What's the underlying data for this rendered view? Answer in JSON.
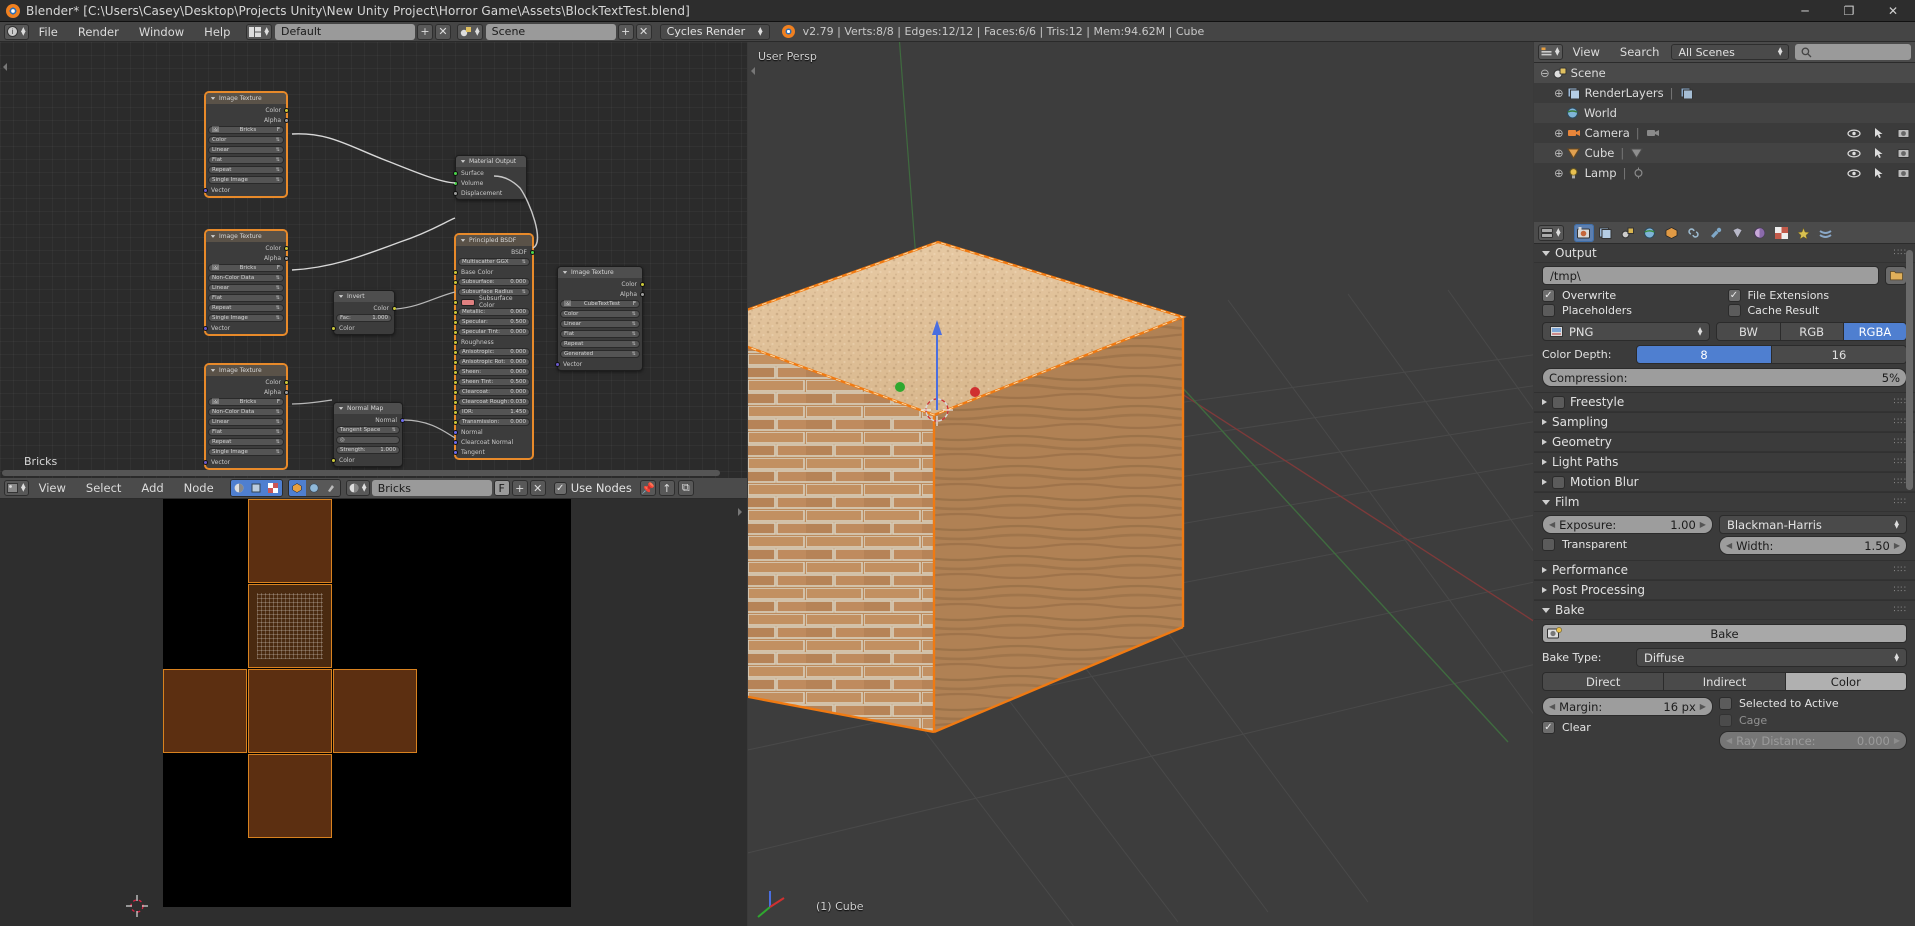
{
  "window": {
    "title": "Blender* [C:\\Users\\Casey\\Desktop\\Projects Unity\\New Unity Project\\Horror Game\\Assets\\BlockTextTest.blend]",
    "minimize": "─",
    "maximize": "❐",
    "close": "✕"
  },
  "topbar": {
    "menus": [
      "File",
      "Render",
      "Window",
      "Help"
    ],
    "screen_layout": "Default",
    "scene_name": "Scene",
    "engine": "Cycles Render",
    "add_label": "+",
    "remove_label": "✕",
    "status": "v2.79 | Verts:8/8 | Edges:12/12 | Faces:6/6 | Tris:12 | Mem:94.62M | Cube"
  },
  "node_editor": {
    "menus": [
      "View",
      "Select",
      "Add",
      "Node"
    ],
    "material": "Bricks",
    "material_f": "F",
    "use_nodes": "Use Nodes",
    "breadcrumb": "Bricks",
    "nodes": [
      {
        "title": "Image Texture",
        "image": "Bricks",
        "outputs": [
          "Color",
          "Alpha"
        ],
        "props": [
          "Color",
          "Linear",
          "Flat",
          "Repeat",
          "Single Image"
        ],
        "inputs": [
          "Vector"
        ]
      },
      {
        "title": "Image Texture",
        "image": "Bricks",
        "outputs": [
          "Color",
          "Alpha"
        ],
        "props": [
          "Non-Color Data",
          "Linear",
          "Flat",
          "Repeat",
          "Single Image"
        ],
        "inputs": [
          "Vector"
        ]
      },
      {
        "title": "Image Texture",
        "image": "Bricks",
        "outputs": [
          "Color",
          "Alpha"
        ],
        "props": [
          "Non-Color Data",
          "Linear",
          "Flat",
          "Repeat",
          "Single Image"
        ],
        "inputs": [
          "Vector"
        ]
      },
      {
        "title": "Invert",
        "outputs": [
          "Color"
        ],
        "fac_label": "Fac:",
        "fac_value": "1.000",
        "inputs": [
          "Color"
        ]
      },
      {
        "title": "Normal Map",
        "outputs": [
          "Normal"
        ],
        "space": "Tangent Space",
        "strength_label": "Strength:",
        "strength_value": "1.000",
        "inputs": [
          "Color"
        ]
      },
      {
        "title": "Material Output",
        "inputs": [
          "Surface",
          "Volume",
          "Displacement"
        ]
      },
      {
        "title": "Principled BSDF",
        "outputs": [
          "BSDF"
        ],
        "distribution": "Multiscatter GGX",
        "rows": [
          {
            "label": "Base Color",
            "value": "",
            "type": "socket"
          },
          {
            "label": "Subsurface:",
            "value": "0.000",
            "type": "num"
          },
          {
            "label": "Subsurface Radius",
            "value": "",
            "type": "dd"
          },
          {
            "label": "Subsurface Color",
            "value": "",
            "type": "color"
          },
          {
            "label": "Metallic:",
            "value": "0.000",
            "type": "num"
          },
          {
            "label": "Specular:",
            "value": "0.500",
            "type": "num"
          },
          {
            "label": "Specular Tint:",
            "value": "0.000",
            "type": "num"
          },
          {
            "label": "Roughness",
            "value": "",
            "type": "socket"
          },
          {
            "label": "Anisotropic:",
            "value": "0.000",
            "type": "num"
          },
          {
            "label": "Anisotropic Rot:",
            "value": "0.000",
            "type": "num"
          },
          {
            "label": "Sheen:",
            "value": "0.000",
            "type": "num"
          },
          {
            "label": "Sheen Tint:",
            "value": "0.500",
            "type": "num"
          },
          {
            "label": "Clearcoat:",
            "value": "0.000",
            "type": "num"
          },
          {
            "label": "Clearcoat Rough:",
            "value": "0.030",
            "type": "num"
          },
          {
            "label": "IOR:",
            "value": "1.450",
            "type": "num"
          },
          {
            "label": "Transmission:",
            "value": "0.000",
            "type": "num"
          },
          {
            "label": "Normal",
            "value": "",
            "type": "socket"
          },
          {
            "label": "Clearcoat Normal",
            "value": "",
            "type": "socket"
          },
          {
            "label": "Tangent",
            "value": "",
            "type": "socket"
          }
        ]
      },
      {
        "title": "Image Texture",
        "image": "CubeTextTest",
        "outputs": [
          "Color",
          "Alpha"
        ],
        "props": [
          "Color",
          "Linear",
          "Flat",
          "Repeat",
          "Generated"
        ],
        "inputs": [
          "Vector"
        ]
      }
    ]
  },
  "uv_editor": {
    "menus": [
      "View",
      "Select",
      "Add",
      "Node"
    ],
    "image_name": "Bricks"
  },
  "viewport": {
    "view_label": "User Persp",
    "object_label": "(1) Cube"
  },
  "outliner": {
    "menus": [
      "View",
      "Search"
    ],
    "display_mode": "All Scenes",
    "search_placeholder": "",
    "items": [
      {
        "label": "Scene",
        "depth": 0,
        "icon": "scene-icon",
        "expanded": true
      },
      {
        "label": "RenderLayers",
        "depth": 1,
        "icon": "renderlayers-icon",
        "expanded": false
      },
      {
        "label": "World",
        "depth": 1,
        "icon": "world-icon",
        "expanded": false
      },
      {
        "label": "Camera",
        "depth": 1,
        "icon": "camera-icon",
        "expanded": false
      },
      {
        "label": "Cube",
        "depth": 1,
        "icon": "mesh-icon",
        "expanded": false
      },
      {
        "label": "Lamp",
        "depth": 1,
        "icon": "lamp-icon",
        "expanded": false
      }
    ]
  },
  "properties": {
    "output": {
      "title": "Output",
      "path": "/tmp\\",
      "overwrite": {
        "label": "Overwrite",
        "checked": true
      },
      "file_extensions": {
        "label": "File Extensions",
        "checked": true
      },
      "placeholders": {
        "label": "Placeholders",
        "checked": false
      },
      "cache_result": {
        "label": "Cache Result",
        "checked": false
      },
      "format": "PNG",
      "channels": [
        "BW",
        "RGB",
        "RGBA"
      ],
      "channels_selected": "RGBA",
      "color_depth_label": "Color Depth:",
      "color_depth_options": [
        "8",
        "16"
      ],
      "color_depth_selected": "8",
      "compression_label": "Compression:",
      "compression_value": "5%"
    },
    "collapsed": [
      {
        "title": "Freestyle",
        "has_checkbox": true,
        "checked": false
      },
      {
        "title": "Sampling",
        "has_checkbox": false
      },
      {
        "title": "Geometry",
        "has_checkbox": false
      },
      {
        "title": "Light Paths",
        "has_checkbox": false
      },
      {
        "title": "Motion Blur",
        "has_checkbox": true,
        "checked": false
      }
    ],
    "film": {
      "title": "Film",
      "exposure_label": "Exposure:",
      "exposure_value": "1.00",
      "filter_type": "Blackman-Harris",
      "width_label": "Width:",
      "width_value": "1.50",
      "transparent": {
        "label": "Transparent",
        "checked": false
      }
    },
    "collapsed2": [
      {
        "title": "Performance"
      },
      {
        "title": "Post Processing"
      }
    ],
    "bake": {
      "title": "Bake",
      "bake_button": "Bake",
      "bake_type_label": "Bake Type:",
      "bake_type_value": "Diffuse",
      "contributions": [
        "Direct",
        "Indirect",
        "Color"
      ],
      "contributions_selected": "Color",
      "margin_label": "Margin:",
      "margin_value": "16 px",
      "clear": {
        "label": "Clear",
        "checked": true
      },
      "selected_to_active": {
        "label": "Selected to Active",
        "checked": false
      },
      "cage": {
        "label": "Cage",
        "checked": false,
        "disabled": true
      },
      "ray_distance_label": "Ray Distance:",
      "ray_distance_value": "0.000"
    }
  },
  "colors": {
    "accent_orange": "#e88a2a",
    "accent_blue": "#4f7fd0",
    "panel_bg": "#3b3b3b",
    "header_bg": "#4b4b4b"
  }
}
